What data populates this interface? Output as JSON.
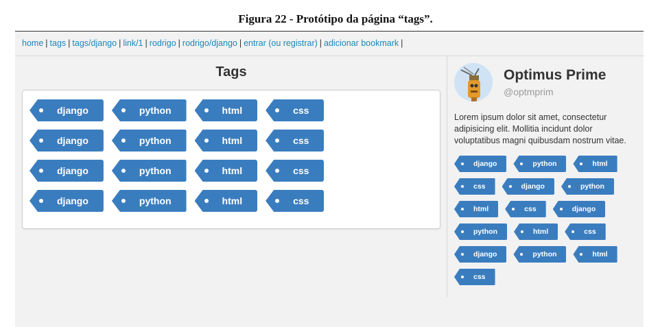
{
  "caption": "Figura 22 - Protótipo da página “tags”.",
  "nav": {
    "links": [
      "home",
      "tags",
      "tags/django",
      "link/1",
      "rodrigo",
      "rodrigo/django",
      "entrar (ou registrar)",
      "adicionar bookmark"
    ],
    "separator": "|"
  },
  "main": {
    "title": "Tags",
    "tags": [
      "django",
      "python",
      "html",
      "css",
      "django",
      "python",
      "html",
      "css",
      "django",
      "python",
      "html",
      "css",
      "django",
      "python",
      "html",
      "css"
    ]
  },
  "profile": {
    "avatar_icon": "robot-avatar-icon",
    "name": "Optimus Prime",
    "handle": "@optmprim",
    "bio": "Lorem ipsum dolor sit amet, consectetur adipisicing elit. Mollitia incidunt dolor voluptatibus magni quibusdam nostrum vitae.",
    "tags": [
      "django",
      "python",
      "html",
      "css",
      "django",
      "python",
      "html",
      "css",
      "django",
      "python",
      "html",
      "css",
      "django",
      "python",
      "html",
      "css"
    ]
  },
  "colors": {
    "tag_bg": "#3a7dbf",
    "link": "#1a87b8"
  }
}
